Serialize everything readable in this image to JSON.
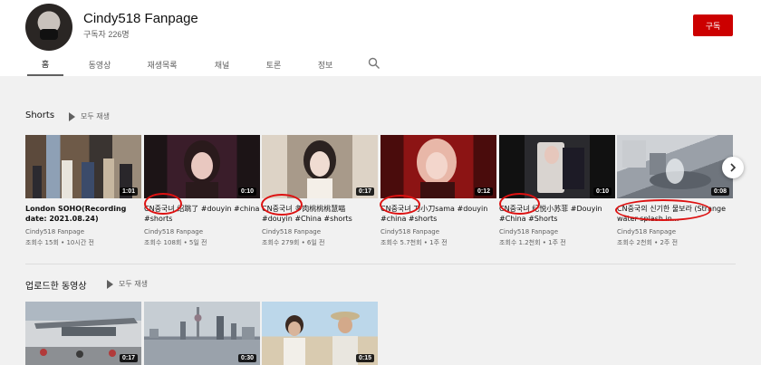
{
  "channel": {
    "name": "Cindy518 Fanpage",
    "subscribers": "구독자 226명",
    "subscribe_label": "구독"
  },
  "tabs": [
    "홈",
    "동영상",
    "재생목록",
    "채널",
    "토론",
    "정보"
  ],
  "icons": {
    "search": "search-icon",
    "next": "chevron-right-icon",
    "play": "play-icon"
  },
  "colors": {
    "subscribe": "#cc0000",
    "annotation": "#dd1111"
  },
  "shorts": {
    "title": "Shorts",
    "play_all": "모두 재생",
    "videos": [
      {
        "title": "London SOHO(Recording date: 2021.08.24)",
        "channel": "Cindy518 Fanpage",
        "meta": "조회수 15회 • 10시간 전",
        "duration": "1:01"
      },
      {
        "title": "CN중국녀 绍跳了 #douyin #china #shorts",
        "channel": "Cindy518 Fanpage",
        "meta": "조회수 108회 • 5일 전",
        "duration": "0:10"
      },
      {
        "title": "CN중국녀 多肉桃桃桃慧喵 #douyin #China #shorts",
        "channel": "Cindy518 Fanpage",
        "meta": "조회수 279회 • 6일 전",
        "duration": "0:17"
      },
      {
        "title": "CN중국녀 刀小刀sama #douyin #china #shorts",
        "channel": "Cindy518 Fanpage",
        "meta": "조회수 5.7천회 • 1주 전",
        "duration": "0:12"
      },
      {
        "title": "CN중국녀 纪悦小苏菲 #Douyin #China #Shorts",
        "channel": "Cindy518 Fanpage",
        "meta": "조회수 1.2천회 • 1주 전",
        "duration": "0:10"
      },
      {
        "title": "CN중국의 신기한 물보라 (Strange water splash in...",
        "channel": "Cindy518 Fanpage",
        "meta": "조회수 2천회 • 2주 전",
        "duration": "0:08"
      }
    ]
  },
  "uploads": {
    "title": "업로드한 동영상",
    "play_all": "모두 재생",
    "videos": [
      {
        "duration": "0:17"
      },
      {
        "duration": "0:30"
      },
      {
        "duration": "0:15"
      }
    ]
  }
}
